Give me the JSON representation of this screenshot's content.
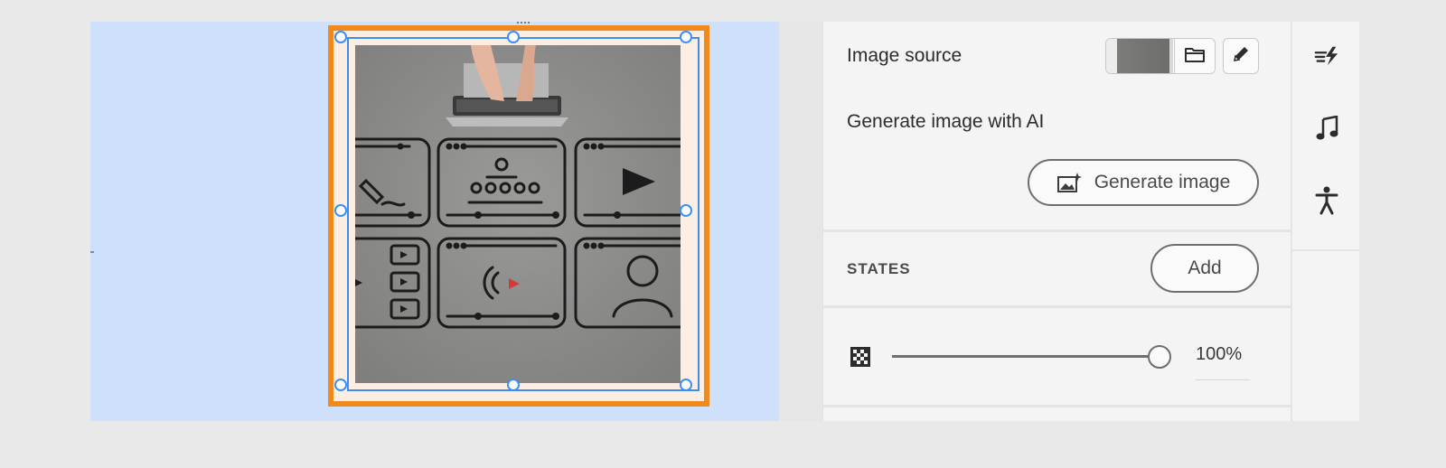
{
  "panel": {
    "image_source_label": "Image source",
    "generate_ai_label": "Generate image with AI",
    "generate_button_label": "Generate image",
    "states_label": "STATES",
    "add_button_label": "Add",
    "opacity_value": "100%",
    "opacity_fraction": 1.0
  },
  "icons": {
    "folder": "folder-icon",
    "edit": "pencil-icon",
    "generate": "image-sparkle-icon",
    "opacity": "checkerboard-icon",
    "rail": [
      "effects-icon",
      "music-note-icon",
      "accessibility-icon"
    ]
  },
  "colors": {
    "canvas_bg": "#cfe0fd",
    "frame_border": "#f08a1c",
    "selection": "#3e8ef0",
    "panel_bg": "#f4f4f4"
  }
}
